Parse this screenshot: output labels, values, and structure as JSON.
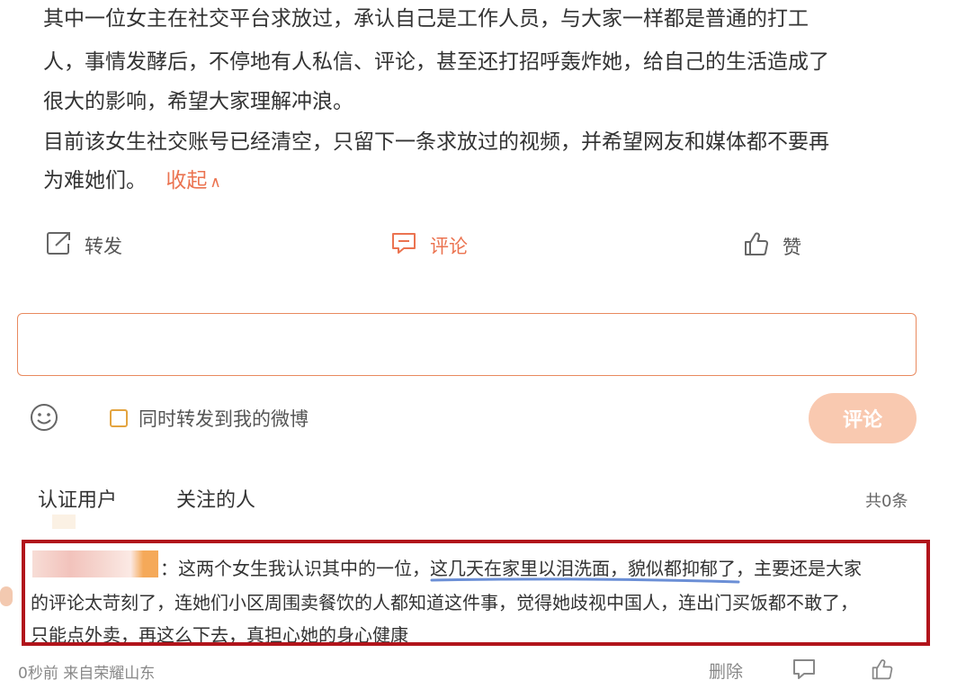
{
  "post": {
    "lines": [
      "其中一位女主在社交平台求放过，承认自己是工作人员，与大家一样都是普通的打工",
      "人，事情发酵后，不停地有人私信、评论，甚至还打招呼轰炸她，给自己的生活造成了",
      "很大的影响，希望大家理解冲浪。",
      "目前该女生社交账号已经清空，只留下一条求放过的视频，并希望网友和媒体都不要再",
      "为难她们。"
    ],
    "collapse_label": "收起",
    "collapse_arrow": "∧"
  },
  "actions": {
    "repost": "转发",
    "comment": "评论",
    "like": "赞"
  },
  "comment_form": {
    "input_value": "",
    "repost_option": "同时转发到我的微博",
    "submit_label": "评论",
    "accent_color": "#eb7350"
  },
  "tabs": {
    "verified_users": "认证用户",
    "following": "关注的人",
    "total": "共0条"
  },
  "comment": {
    "line1": "：这两个女生我认识其中的一位，这几天在家里以泪洗面，貌似都抑郁了，主要还是大家",
    "line2": "的评论太苛刻了，连她们小区周围卖餐饮的人都知道这件事，觉得她歧视中国人，连出门买饭都不敢了，",
    "line3": "只能点外卖，再这么下去，真担心她的身心健康",
    "meta": "0秒前 来自荣耀山东",
    "delete_label": "删除",
    "highlight_color": "#b1141b"
  }
}
